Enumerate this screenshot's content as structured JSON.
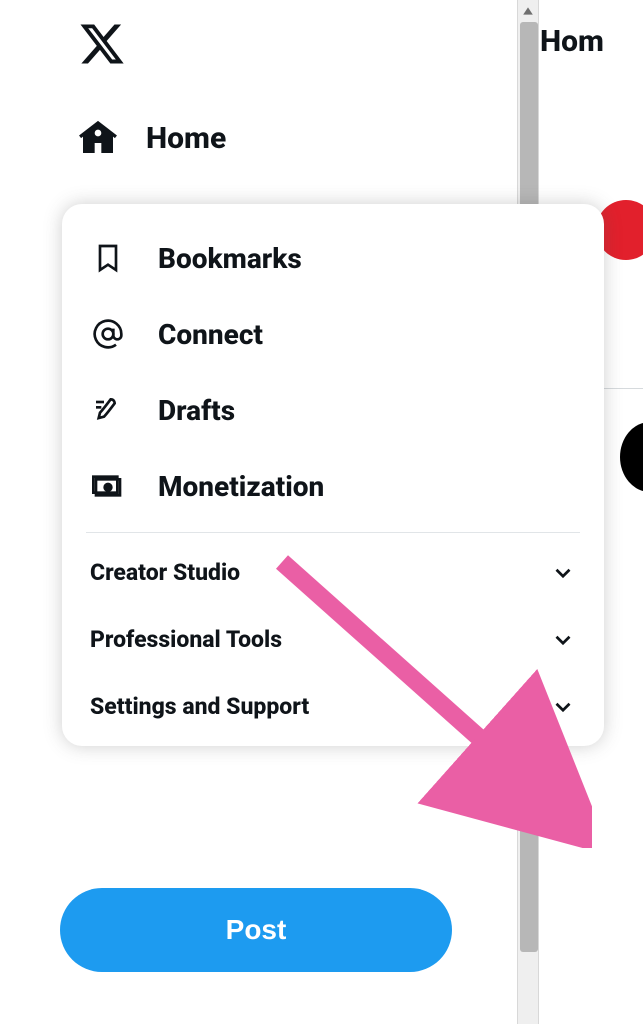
{
  "nav": {
    "home": "Home"
  },
  "popover": {
    "bookmarks": "Bookmarks",
    "connect": "Connect",
    "drafts": "Drafts",
    "monetization": "Monetization",
    "creator_studio": "Creator Studio",
    "professional_tools": "Professional Tools",
    "settings_support": "Settings and Support"
  },
  "post_button": "Post",
  "right_header": "Hom",
  "colors": {
    "primary": "#1d9bf0",
    "arrow": "#ea5fa5"
  }
}
